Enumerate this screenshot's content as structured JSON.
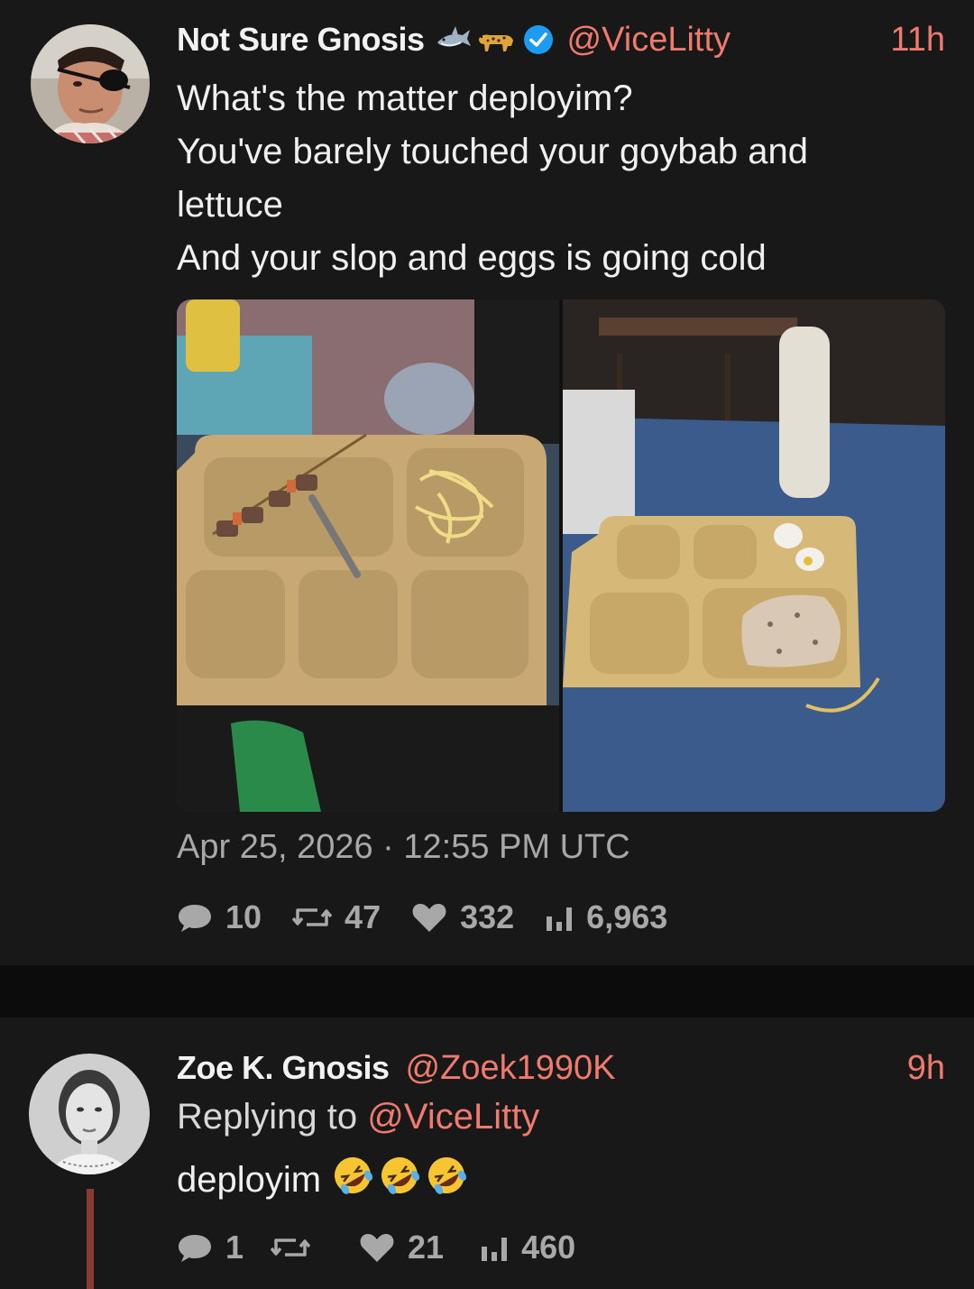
{
  "colors": {
    "accent": "#f07a6e",
    "background": "#181818",
    "muted": "#a8a8a8",
    "verified": "#1d9bf0",
    "thread_line": "#8a3a34"
  },
  "main_post": {
    "display_name": "Not Sure Gnosis",
    "name_emojis": [
      "shark-emoji",
      "leopard-emoji"
    ],
    "verified_icon": "verified-badge-icon",
    "handle": "@ViceLitty",
    "time": "11h",
    "text_lines": [
      "What's the matter deployim?",
      "You've barely touched your goybab and",
      "lettuce",
      "And your slop and eggs is going cold"
    ],
    "media": [
      {
        "icon": "photo-tray-kebab-noodles"
      },
      {
        "icon": "photo-tray-gravy-eggs"
      }
    ],
    "date": "Apr 25, 2026",
    "separator": "·",
    "clock": "12:55 PM UTC",
    "stats": {
      "replies": "10",
      "reposts": "47",
      "likes": "332",
      "views": "6,963"
    }
  },
  "reply_post": {
    "display_name": "Zoe K. Gnosis",
    "handle": "@Zoek1990K",
    "time": "9h",
    "replying_prefix": "Replying to",
    "replying_to": "@ViceLitty",
    "text": "deployim",
    "emojis": [
      "rolling-on-floor-laughing-emoji",
      "rolling-on-floor-laughing-emoji",
      "rolling-on-floor-laughing-emoji"
    ],
    "stats": {
      "replies": "1",
      "reposts": "",
      "likes": "21",
      "views": "460"
    }
  }
}
